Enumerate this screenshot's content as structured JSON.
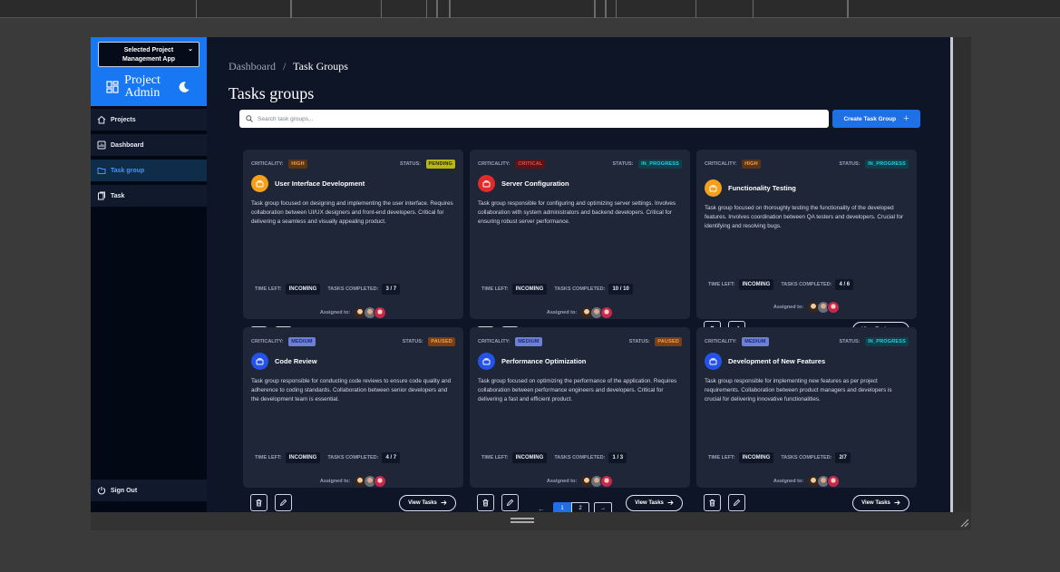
{
  "sidebar": {
    "project_select": {
      "label_line1": "Selected Project",
      "label_line2": "Management App"
    },
    "brand_line1": "Project",
    "brand_line2": "Admin",
    "items": [
      {
        "label": "Projects",
        "icon": "home-icon"
      },
      {
        "label": "Dashboard",
        "icon": "dashboard-icon"
      },
      {
        "label": "Task group",
        "icon": "folder-icon",
        "active": true
      },
      {
        "label": "Task",
        "icon": "task-icon"
      }
    ],
    "sign_out": "Sign Out"
  },
  "breadcrumb": {
    "root": "Dashboard",
    "sep": "/",
    "current": "Task Groups"
  },
  "page_title": "Tasks groups",
  "search": {
    "placeholder": "Search task groups..."
  },
  "create_button": "Create Task Group",
  "labels": {
    "criticality": "CRITICALITY:",
    "status": "STATUS:",
    "time_left": "TIME LEFT:",
    "tasks_completed": "TASKS COMPLETED:",
    "assigned_to": "Assigned to:",
    "view_tasks": "View Tasks"
  },
  "cards": [
    {
      "criticality": "HIGH",
      "status": "PENDING",
      "title": "User Interface Development",
      "description": "Task group focused on designing and implementing the user interface. Requires collaboration between UI/UX designers and front-end developers. Critical for delivering a seamless and visually appealing product.",
      "time_left": "INCOMING",
      "tasks_completed": "3 / 7"
    },
    {
      "criticality": "CRITICAL",
      "status": "IN_PROGRESS",
      "title": "Server Configuration",
      "description": "Task group responsible for configuring and optimizing server settings. Involves collaboration with system administrators and backend developers. Critical for ensuring robust server performance.",
      "time_left": "INCOMING",
      "tasks_completed": "10 / 10"
    },
    {
      "criticality": "HIGH",
      "status": "IN_PROGRESS",
      "title": "Functionality Testing",
      "description": "Task group focused on thoroughly testing the functionality of the developed features. Involves coordination between QA testers and developers. Crucial for identifying and resolving bugs.",
      "time_left": "INCOMING",
      "tasks_completed": "4 / 6"
    },
    {
      "criticality": "MEDIUM",
      "status": "PAUSED",
      "title": "Code Review",
      "description": "Task group responsible for conducting code reviews to ensure code quality and adherence to coding standards. Collaboration between senior developers and the development team is essential.",
      "time_left": "INCOMING",
      "tasks_completed": "4 / 7"
    },
    {
      "criticality": "MEDIUM",
      "status": "PAUSED",
      "title": "Performance Optimization",
      "description": "Task group focused on optimizing the performance of the application. Requires collaboration between performance engineers and developers. Critical for delivering a fast and efficient product.",
      "time_left": "INCOMING",
      "tasks_completed": "1 / 3"
    },
    {
      "criticality": "MEDIUM",
      "status": "IN_PROGRESS",
      "title": "Development of New Features",
      "description": "Task group responsible for implementing new features as per project requirements. Collaboration between product managers and developers is crucial for delivering innovative functionalities.",
      "time_left": "INCOMING",
      "tasks_completed": "2/7"
    }
  ],
  "pagination": {
    "prev": "←",
    "pages": [
      "1",
      "2"
    ],
    "current": "1",
    "next": "→"
  },
  "colors": {
    "accent": "#1f6fe5",
    "brand": "#1877f2",
    "background": "#0d1526",
    "card": "#1e2638"
  }
}
